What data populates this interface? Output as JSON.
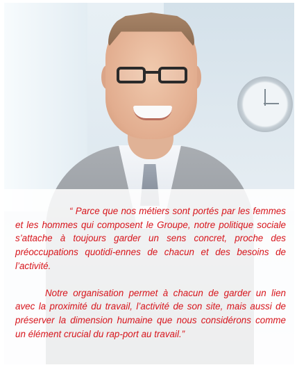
{
  "photo": {
    "subject": "portrait-photo"
  },
  "quote": {
    "paragraph_1": "“ Parce que nos métiers sont portés par les femmes et les hommes qui composent le Groupe, notre politique sociale s’attache à toujours garder un sens concret, proche des préoccupations quotidi-ennes de chacun et des besoins de l’activité.",
    "paragraph_2": "Notre organisation permet à chacun de garder un lien avec la proximité du travail, l’activité de son site, mais aussi de préserver la dimension humaine que nous considérons comme un élément crucial du rap-port au travail.”",
    "color": "#d7141b"
  }
}
